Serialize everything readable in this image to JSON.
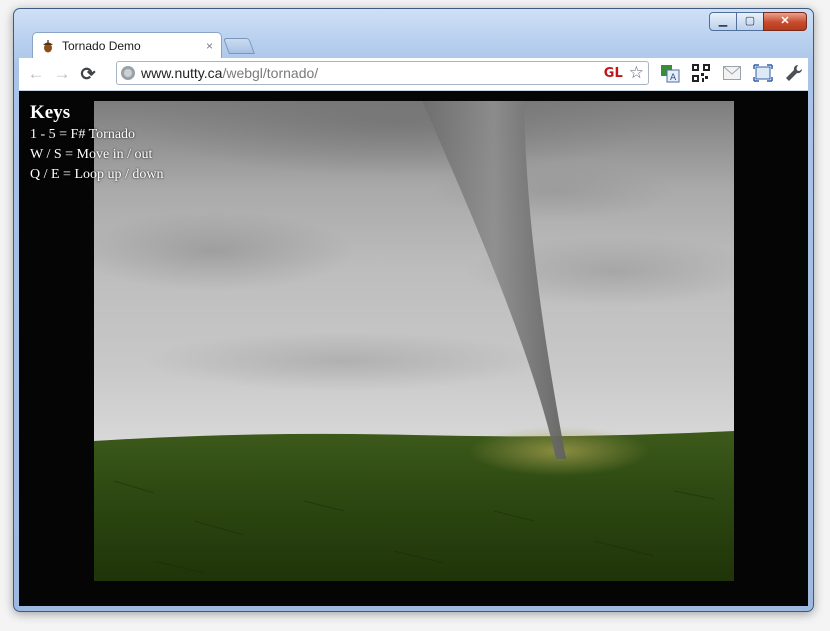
{
  "browser": {
    "tab": {
      "title": "Tornado Demo",
      "close_glyph": "×",
      "favicon": "acorn-icon"
    },
    "nav": {
      "back": "←",
      "forward": "→",
      "reload": "⟳"
    },
    "address": {
      "domain": "www.nutty.ca",
      "path": "/webgl/tornado/",
      "gl_badge": "GL",
      "star": "☆"
    },
    "window_controls": {
      "minimize": "▁",
      "maximize": "▢",
      "close": "✕"
    },
    "toolbar_icons": [
      "translate-icon",
      "qr-code-icon",
      "mail-icon",
      "fullscreen-icon",
      "wrench-icon"
    ]
  },
  "page": {
    "keys_title": "Keys",
    "key_lines": [
      "1 - 5 = F# Tornado",
      "W / S = Move in / out",
      "Q / E = Loop up / down"
    ]
  },
  "colors": {
    "grass": "#2e4a12",
    "sky": "#c8c8c8",
    "background": "#050505",
    "gl_badge": "#c0151b"
  }
}
